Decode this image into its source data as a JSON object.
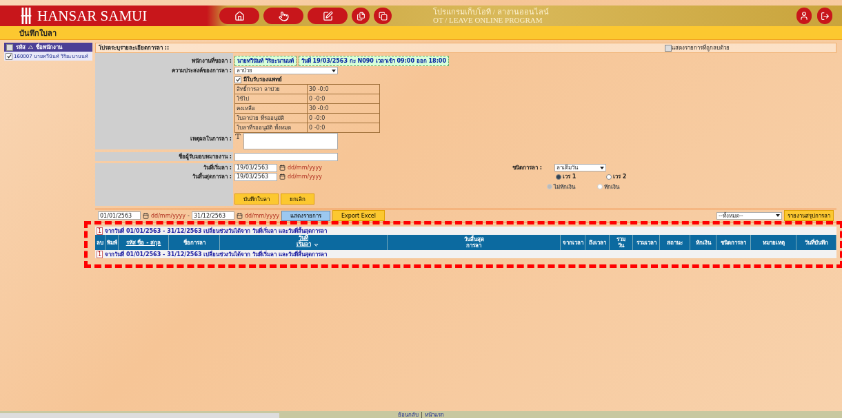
{
  "header": {
    "logo": "HANSAR SAMUI",
    "program_title": "โปรแกรมเก็บโอที / ลางานออนไลน์",
    "program_subtitle": "OT / LEAVE ONLINE PROGRAM"
  },
  "page_title": "บันทึกใบลา",
  "sidebar": {
    "header_checked": false,
    "columns": [
      "รหัส",
      "ชื่อพนักงาน"
    ],
    "rows": [
      {
        "code": "160007",
        "name": "นายทวีนันท์ วิริยะนานนท์",
        "checked": true
      }
    ]
  },
  "panel": {
    "title": "โปรดระบุรายละเอียดการลา ::",
    "show_deleted": {
      "label": "แสดงรายการที่ถูกลบด้วย",
      "checked": false
    }
  },
  "form": {
    "employee": {
      "label": "พนักงานที่ขอลา :",
      "name": "นายทวีนันท์ วิริยะนานนท์",
      "shift": "วันที่ 19/03/2563 กะ N090 เวลาเข้า 09:00 ออก 18:00"
    },
    "purpose": {
      "label": "ความประสงค์ของการลา :",
      "value": "ลาป่วย"
    },
    "medical_cert": {
      "label": "มีใบรับรองแพทย์",
      "checked": true
    },
    "balance": [
      {
        "label": "สิทธิ์การลา ลาป่วย",
        "value": "30 -0:0"
      },
      {
        "label": "ใช้ไป",
        "value": "0 -0:0"
      },
      {
        "label": "คงเหลือ",
        "value": "30 -0:0"
      },
      {
        "label": "ใบลาป่วย ที่รออนุมัติ",
        "value": "0 -0:0"
      },
      {
        "label": "ใบลาที่รออนุมัติ ทั้งหมด",
        "value": "0 -0:0"
      }
    ],
    "reason": {
      "label": "เหตุผลในการลา :"
    },
    "handover": {
      "label": "ชื่อผู้รับมอบหมายงาน :"
    },
    "start_date": {
      "label": "วันที่เริ่มลา :",
      "value": "19/03/2563",
      "hint": "dd/mm/yyyy"
    },
    "end_date": {
      "label": "วันสิ้นสุดการลา :",
      "value": "19/03/2563",
      "hint": "dd/mm/yyyy"
    },
    "leave_type": {
      "label": "ชนิดการลา :",
      "value": "ลาเต็มวัน"
    },
    "shifts": [
      {
        "label": "เวร 1",
        "selected": true,
        "disabled": false
      },
      {
        "label": "เวร 2",
        "selected": false,
        "disabled": false
      }
    ],
    "deduction": [
      {
        "label": "ไม่หักเงิน",
        "selected": true,
        "disabled": true
      },
      {
        "label": "หักเงิน",
        "selected": false,
        "disabled": true
      }
    ],
    "buttons": [
      "บันทึกใบลา",
      "ยกเลิก"
    ]
  },
  "filter": {
    "from": "01/01/2563",
    "from_hint": "dd/mm/yyyy",
    "separator": "-",
    "to": "31/12/2563",
    "to_hint": "dd/mm/yyyy",
    "show_button": "แสดงรายการ",
    "export_button": "Export Excel",
    "status_select": "--ทั้งหมด--",
    "report_button": "รายงานสรุปการลา"
  },
  "table": {
    "note_top": {
      "page": "1",
      "text": "จากวันที่ 01/01/2563 - 31/12/2563 เปลี่ยนช่วงวันได้จาก วันที่เริ่มลา และวันที่สิ้นสุดการลา"
    },
    "columns": [
      {
        "lines": [
          "ลบ"
        ],
        "link": false
      },
      {
        "lines": [
          "พิมพ์"
        ],
        "link": false
      },
      {
        "lines": [
          "รหัส ชื่อ - สกุล"
        ],
        "link": true
      },
      {
        "lines": [
          "ชื่อการลา"
        ],
        "link": false
      },
      {
        "lines": [
          "วันที่",
          "เริ่มลา"
        ],
        "link": true,
        "sorted": true
      },
      {
        "lines": [
          "วันสิ้นสุด",
          "การลา"
        ],
        "link": false
      },
      {
        "lines": [
          "จากเวลา"
        ],
        "link": false
      },
      {
        "lines": [
          "ถึงเวลา"
        ],
        "link": false
      },
      {
        "lines": [
          "รวม",
          "วัน"
        ],
        "link": false
      },
      {
        "lines": [
          "รวมเวลา"
        ],
        "link": false
      },
      {
        "lines": [
          "สถานะ"
        ],
        "link": false
      },
      {
        "lines": [
          "หักเงิน"
        ],
        "link": false
      },
      {
        "lines": [
          "ชนิดการลา"
        ],
        "link": false
      },
      {
        "lines": [
          "หมายเหตุ"
        ],
        "link": false
      },
      {
        "lines": [
          "วันที่บันทึก"
        ],
        "link": false
      }
    ],
    "note_bottom": {
      "page": "1",
      "text": "จากวันที่ 01/01/2563 - 31/12/2563 เปลี่ยนช่วงวันได้จาก วันที่เริ่มลา และวันที่สิ้นสุดการลา"
    }
  },
  "footer": {
    "links": [
      "ย้อนกลับ",
      "หน้าแรก"
    ],
    "separator": "|"
  }
}
